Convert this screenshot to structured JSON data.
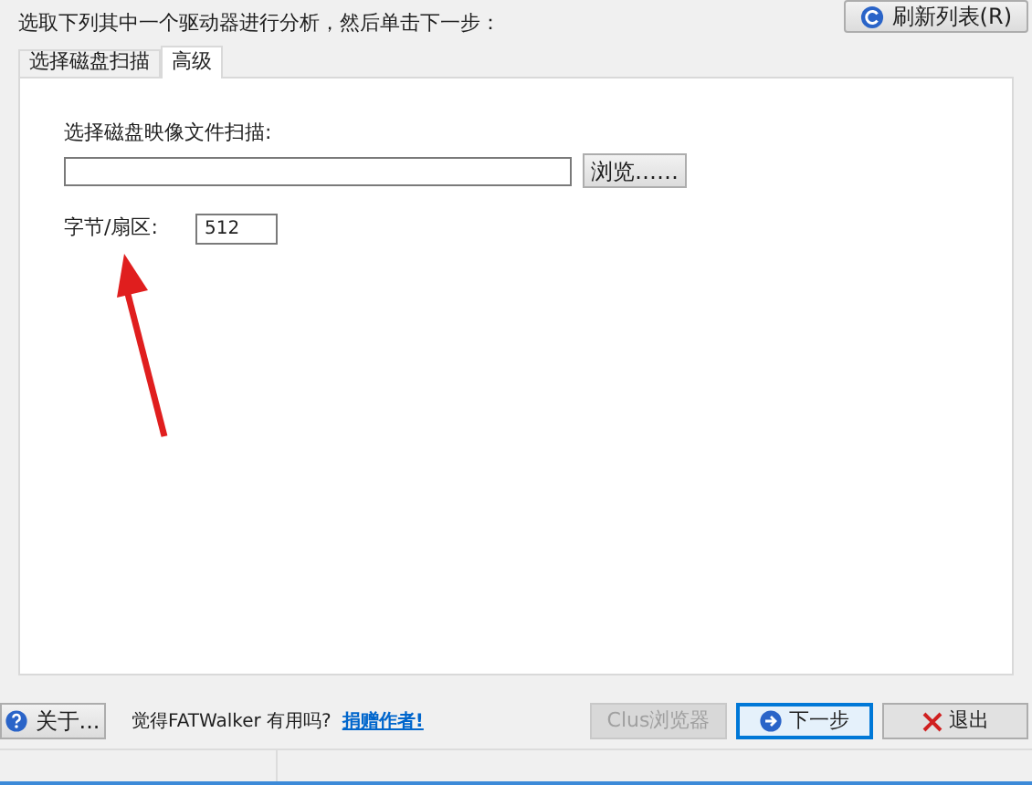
{
  "instruction": "选取下列其中一个驱动器进行分析，然后单击下一步：",
  "refresh_button": "刷新列表(R)",
  "tabs": [
    {
      "label": "选择磁盘扫描",
      "selected": false
    },
    {
      "label": "高级",
      "selected": true
    }
  ],
  "image_file": {
    "label": "选择磁盘映像文件扫描:",
    "browse_button": "浏览……"
  },
  "bytes_per_sector": {
    "label": "字节/扇区:",
    "value": "512"
  },
  "footer": {
    "about_button": "关于...",
    "prompt": "觉得FATWalker 有用吗?",
    "donate_link": "捐赠作者!",
    "buttons": [
      {
        "label": "Clus浏览器",
        "disabled": true,
        "kind": "plain"
      },
      {
        "label": "下一步",
        "disabled": false,
        "kind": "next"
      },
      {
        "label": "退出",
        "disabled": false,
        "kind": "exit"
      }
    ]
  }
}
